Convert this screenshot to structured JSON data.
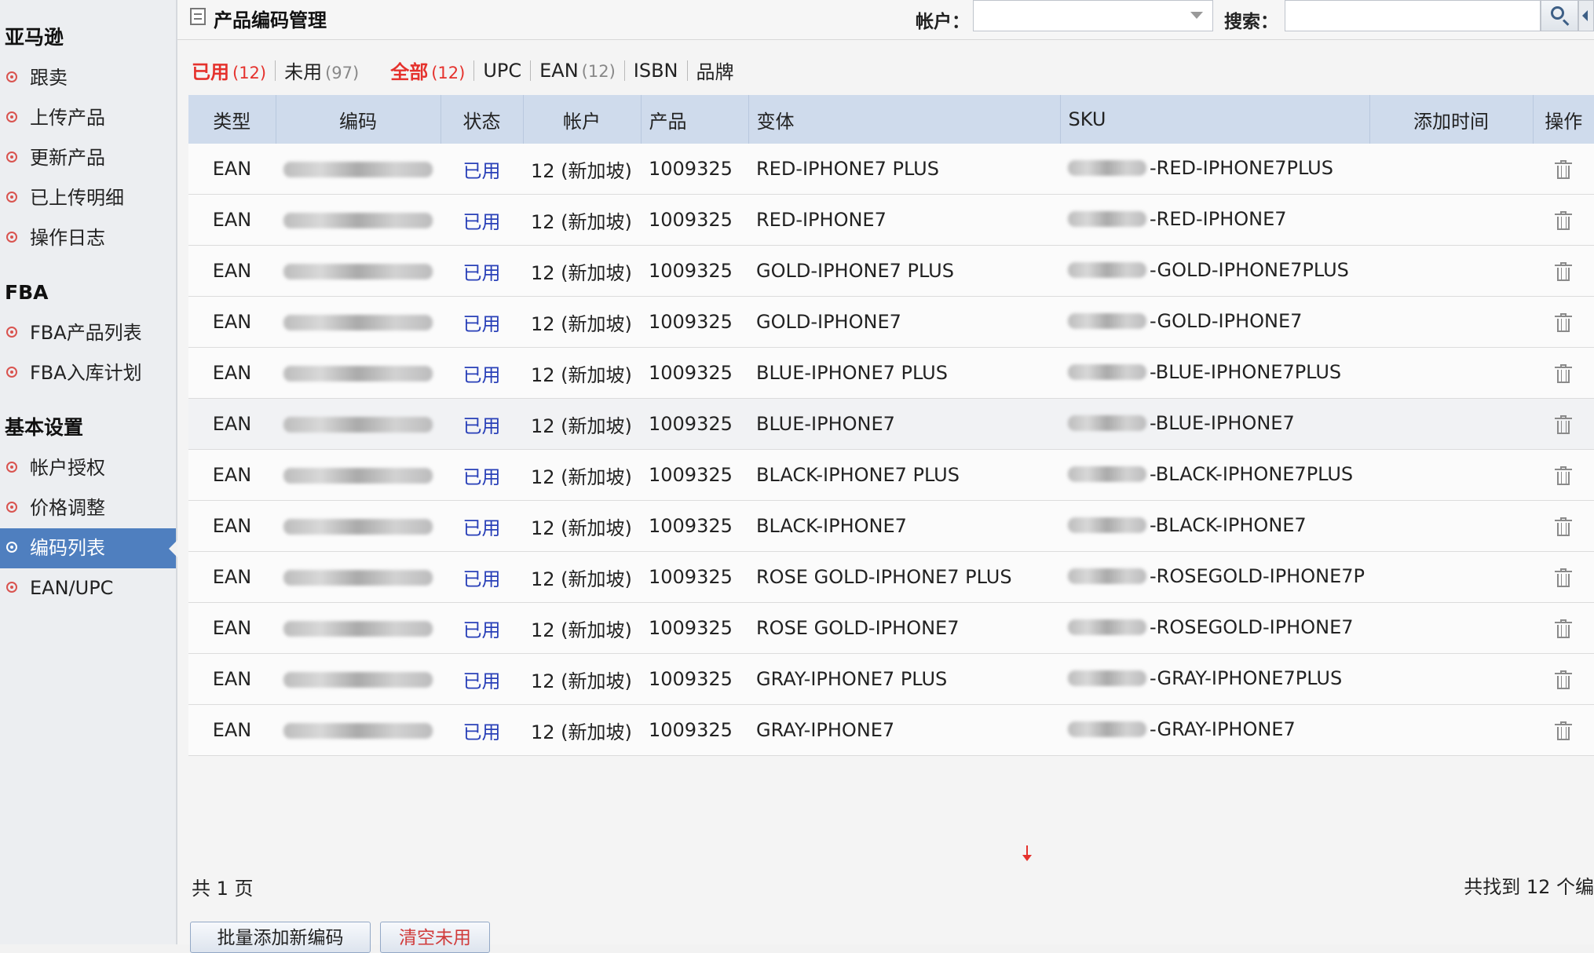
{
  "sidebar": {
    "sections": [
      {
        "title": "亚马逊",
        "items": [
          {
            "label": "跟卖"
          },
          {
            "label": "上传产品"
          },
          {
            "label": "更新产品"
          },
          {
            "label": "已上传明细"
          },
          {
            "label": "操作日志"
          }
        ]
      },
      {
        "title": "FBA",
        "items": [
          {
            "label": "FBA产品列表"
          },
          {
            "label": "FBA入库计划"
          }
        ]
      },
      {
        "title": "基本设置",
        "items": [
          {
            "label": "帐户授权"
          },
          {
            "label": "价格调整"
          },
          {
            "label": "编码列表",
            "active": true
          },
          {
            "label": "EAN/UPC"
          }
        ]
      }
    ]
  },
  "header": {
    "title": "产品编码管理",
    "account_label": "帐户：",
    "account_value": "",
    "search_label": "搜索：",
    "search_value": ""
  },
  "filters": {
    "used": {
      "label": "已用",
      "count": "(12)"
    },
    "unused": {
      "label": "未用",
      "count": "(97)"
    },
    "all": {
      "label": "全部",
      "count": "(12)"
    },
    "upc": {
      "label": "UPC"
    },
    "ean": {
      "label": "EAN",
      "count": "(12)"
    },
    "isbn": {
      "label": "ISBN"
    },
    "brand": {
      "label": "品牌"
    }
  },
  "table": {
    "headers": [
      "类型",
      "编码",
      "状态",
      "帐户",
      "产品",
      "变体",
      "SKU",
      "添加时间",
      "操作"
    ],
    "rows": [
      {
        "type": "EAN",
        "status": "已用",
        "account": "12 (新加坡)",
        "product": "1009325",
        "variant": "RED-IPHONE7 PLUS",
        "sku": "-RED-IPHONE7PLUS"
      },
      {
        "type": "EAN",
        "status": "已用",
        "account": "12 (新加坡)",
        "product": "1009325",
        "variant": "RED-IPHONE7",
        "sku": "-RED-IPHONE7"
      },
      {
        "type": "EAN",
        "status": "已用",
        "account": "12 (新加坡)",
        "product": "1009325",
        "variant": "GOLD-IPHONE7 PLUS",
        "sku": "-GOLD-IPHONE7PLUS"
      },
      {
        "type": "EAN",
        "status": "已用",
        "account": "12 (新加坡)",
        "product": "1009325",
        "variant": "GOLD-IPHONE7",
        "sku": "-GOLD-IPHONE7"
      },
      {
        "type": "EAN",
        "status": "已用",
        "account": "12 (新加坡)",
        "product": "1009325",
        "variant": "BLUE-IPHONE7 PLUS",
        "sku": "-BLUE-IPHONE7PLUS"
      },
      {
        "type": "EAN",
        "status": "已用",
        "account": "12 (新加坡)",
        "product": "1009325",
        "variant": "BLUE-IPHONE7",
        "sku": "-BLUE-IPHONE7"
      },
      {
        "type": "EAN",
        "status": "已用",
        "account": "12 (新加坡)",
        "product": "1009325",
        "variant": "BLACK-IPHONE7 PLUS",
        "sku": "-BLACK-IPHONE7PLUS"
      },
      {
        "type": "EAN",
        "status": "已用",
        "account": "12 (新加坡)",
        "product": "1009325",
        "variant": "BLACK-IPHONE7",
        "sku": "-BLACK-IPHONE7"
      },
      {
        "type": "EAN",
        "status": "已用",
        "account": "12 (新加坡)",
        "product": "1009325",
        "variant": "ROSE GOLD-IPHONE7 PLUS",
        "sku": "-ROSEGOLD-IPHONE7P"
      },
      {
        "type": "EAN",
        "status": "已用",
        "account": "12 (新加坡)",
        "product": "1009325",
        "variant": "ROSE GOLD-IPHONE7",
        "sku": "-ROSEGOLD-IPHONE7"
      },
      {
        "type": "EAN",
        "status": "已用",
        "account": "12 (新加坡)",
        "product": "1009325",
        "variant": "GRAY-IPHONE7 PLUS",
        "sku": "-GRAY-IPHONE7PLUS"
      },
      {
        "type": "EAN",
        "status": "已用",
        "account": "12 (新加坡)",
        "product": "1009325",
        "variant": "GRAY-IPHONE7",
        "sku": "-GRAY-IPHONE7"
      }
    ]
  },
  "footer": {
    "page_count": "共 1 页",
    "result_count": "共找到 12 个编",
    "add_button": "批量添加新编码",
    "clear_button": "清空未用"
  },
  "icons": {
    "status_dot": "circle-dot-icon",
    "search": "search-icon",
    "dropdown": "chevron-down-icon",
    "delete": "trash-icon",
    "collapse": "chevron-left-icon",
    "title": "document-icon"
  },
  "colors": {
    "sidebar_active": "#4f7fbf",
    "header_row": "#cfdbec",
    "filter_active": "#e5322d",
    "status_link": "#2940b8",
    "bullet": "#d9534f"
  }
}
